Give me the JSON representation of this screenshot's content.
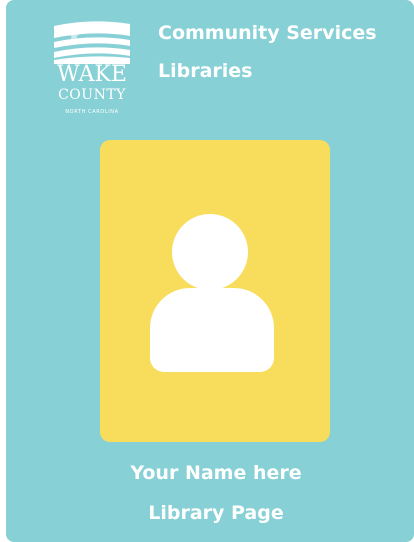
{
  "logo": {
    "name": "wake-county-logo",
    "line1": "WAKE",
    "line2": "COUNTY",
    "line3": "NORTH CAROLINA"
  },
  "header": {
    "line1": "Community Services",
    "line2": "Libraries"
  },
  "photo": {
    "placeholder_icon": "person-icon"
  },
  "name": {
    "line1": "Your Name here",
    "line2": "Library Page"
  },
  "colors": {
    "background": "#86d0d6",
    "photo": "#f8dc5c",
    "text": "#ffffff"
  }
}
